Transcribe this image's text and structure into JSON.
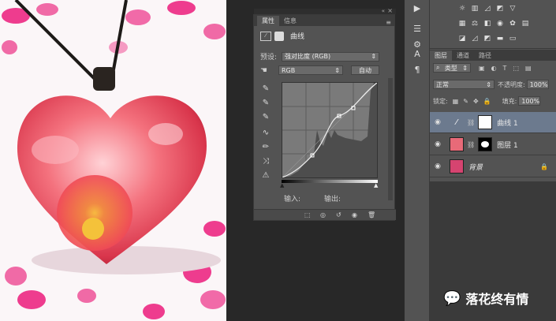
{
  "properties_panel": {
    "tabs": [
      "属性",
      "信息"
    ],
    "title": "曲线",
    "preset_label": "预设:",
    "preset_value": "强对比度 (RGB)",
    "channel_value": "RGB",
    "auto_button": "自动",
    "input_label": "输入:",
    "output_label": "输出:"
  },
  "layers_panel": {
    "tabs": [
      "图层",
      "通道",
      "路径"
    ],
    "filter_kind": "类型",
    "blend_mode": "正常",
    "opacity_label": "不透明度:",
    "opacity_value": "100%",
    "lock_label": "锁定:",
    "fill_label": "填充:",
    "fill_value": "100%",
    "layers": [
      {
        "name": "曲线 1",
        "selected": true
      },
      {
        "name": "图层 1",
        "selected": false
      },
      {
        "name": "背景",
        "selected": false
      }
    ]
  },
  "watermark": {
    "text": "落花终有情"
  },
  "colors": {
    "panel": "#535353",
    "selected_layer": "#6c7a8e",
    "workspace": "#282828"
  }
}
